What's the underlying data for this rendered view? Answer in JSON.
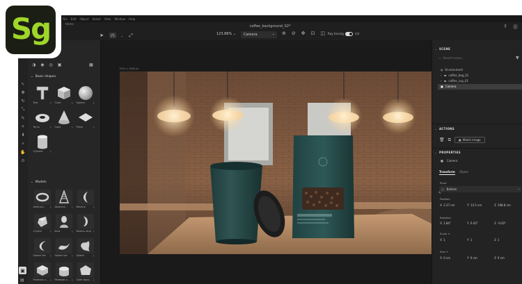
{
  "logo": {
    "text": "Sg"
  },
  "menu": [
    "File",
    "Edit",
    "Object",
    "Select",
    "View",
    "Window",
    "Help"
  ],
  "home_label": "Home",
  "document": {
    "title": "coffee_background_02*"
  },
  "toolbar": {
    "zoom": "123.86%",
    "camera": "Camera",
    "ray_tracing_label": "Ray tracing",
    "ray_tracing_on": true
  },
  "canvas": {
    "size_label": "1920 × 1080 px"
  },
  "assets": {
    "basic_shapes_title": "Basic shapes",
    "basic_shapes": [
      {
        "label": "Text",
        "icon": "text-3d-icon"
      },
      {
        "label": "Cube",
        "icon": "cube-icon"
      },
      {
        "label": "Sphere",
        "icon": "sphere-icon"
      },
      {
        "label": "Torus",
        "icon": "torus-icon"
      },
      {
        "label": "Cone",
        "icon": "cone-icon"
      },
      {
        "label": "Plane",
        "icon": "plane-icon"
      },
      {
        "label": "Cylinder",
        "icon": "cylinder-icon"
      }
    ],
    "models_title": "Models",
    "models": [
      {
        "label": "Abstract...",
        "icon": "abstract-ring-icon"
      },
      {
        "label": "Abstract...",
        "icon": "abstract-spiral-icon"
      },
      {
        "label": "Banana",
        "icon": "banana-icon"
      },
      {
        "label": "Crystal",
        "icon": "crystal-icon"
      },
      {
        "label": "Bust",
        "icon": "bust-icon"
      },
      {
        "label": "Mobius strip",
        "icon": "mobius-icon"
      },
      {
        "label": "Splash lite",
        "icon": "splash-lite-icon"
      },
      {
        "label": "Splash lab",
        "icon": "splash-lab-icon"
      },
      {
        "label": "Splash",
        "icon": "splash-icon"
      },
      {
        "label": "Pedestal a...",
        "icon": "pedestal-a-icon"
      },
      {
        "label": "Pedestal o...",
        "icon": "pedestal-o-icon"
      },
      {
        "label": "Cloth back...",
        "icon": "cloth-icon"
      }
    ]
  },
  "scene_panel": {
    "title": "SCENE",
    "search_placeholder": "Search scene...",
    "items": [
      {
        "label": "Environment",
        "icon": "environment-icon"
      },
      {
        "label": "coffee_bag_01",
        "icon": "folder-icon"
      },
      {
        "label": "coffee_cup_01",
        "icon": "folder-icon"
      },
      {
        "label": "Camera",
        "icon": "camera-icon"
      }
    ]
  },
  "actions_panel": {
    "title": "ACTIONS",
    "match_image_label": "Match image"
  },
  "properties_panel": {
    "title": "PROPERTIES",
    "object_name": "Camera",
    "tabs": [
      "Transform",
      "Object"
    ],
    "pivot_label": "Pivot",
    "pivot_value": "Bottom",
    "position_label": "Position",
    "position": {
      "x": "2.37 cm",
      "y": "13.5 cm",
      "z": "108.8 cm"
    },
    "rotation_label": "Rotation",
    "rotation": {
      "x": "1.84°",
      "y": "0.43°",
      "z": "-0.02°"
    },
    "scale_label": "Scale",
    "scale": {
      "x": "1",
      "y": "1",
      "z": "1"
    },
    "size_label": "Size",
    "size": {
      "x": "0 cm",
      "y": "0 cm",
      "z": "0 cm"
    }
  },
  "colors": {
    "accent_logo": "#9fd62a",
    "panel_bg": "#232323",
    "canvas_bg": "#1a1a1a"
  }
}
